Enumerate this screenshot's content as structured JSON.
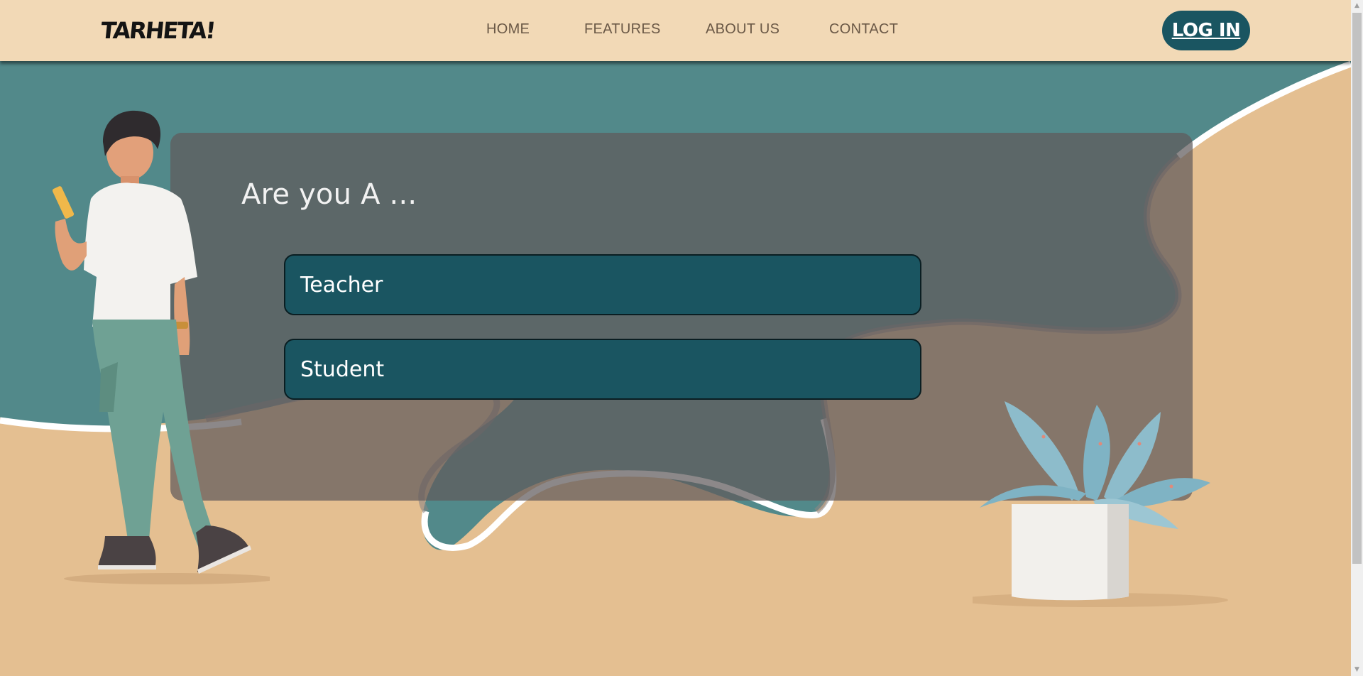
{
  "header": {
    "logo": "TARHETA!",
    "nav": {
      "home": "HOME",
      "features": "FEATURES",
      "about": "ABOUT US",
      "contact": "CONTACT"
    },
    "login_label": "LOG IN"
  },
  "main": {
    "prompt": "Are you A ...",
    "options": [
      "Teacher",
      "Student"
    ]
  },
  "colors": {
    "header_bg": "#f2d9b6",
    "teal_blob": "#52898a",
    "sand": "#e4bf91",
    "button_teal": "#1a5561"
  },
  "icons": {
    "scroll_up": "▲",
    "scroll_down": "▼"
  }
}
